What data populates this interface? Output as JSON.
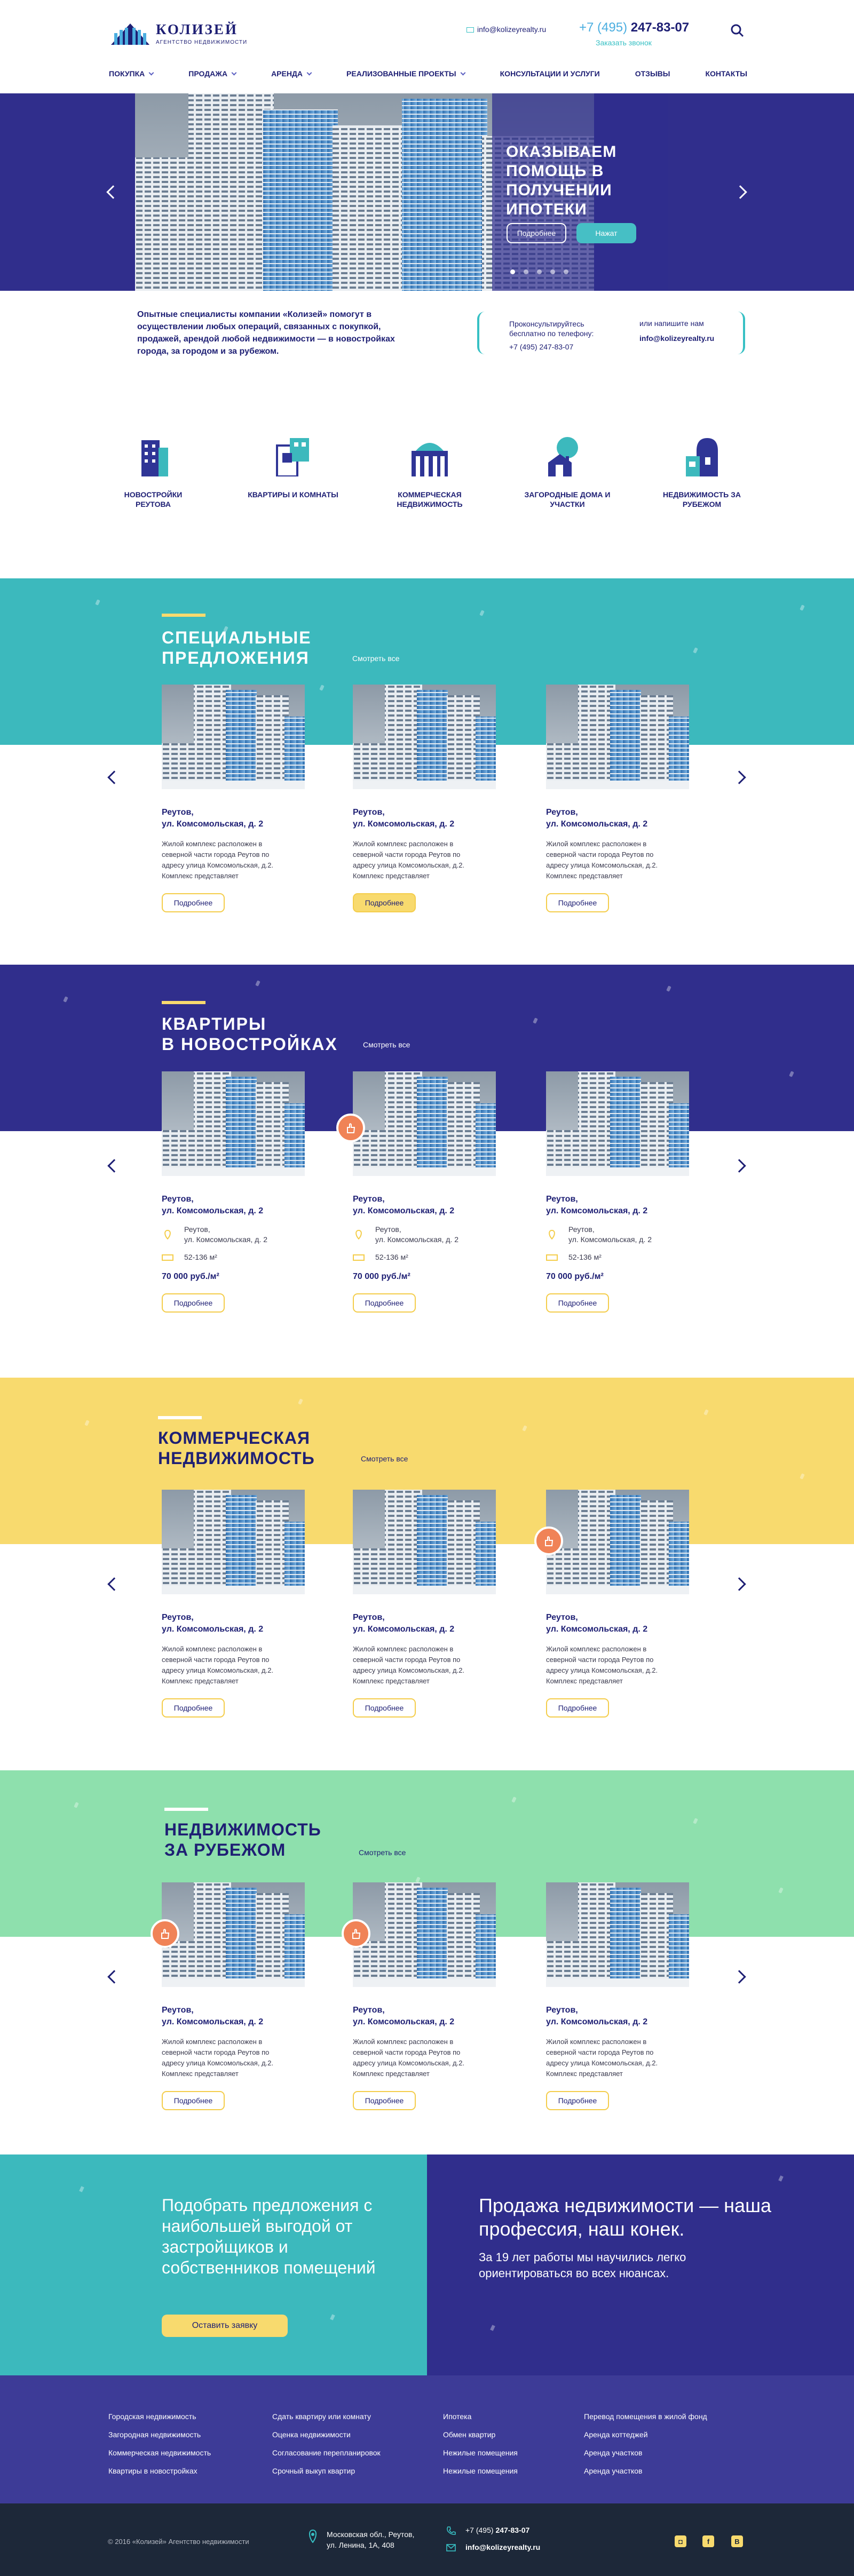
{
  "header": {
    "logo_name": "КОЛИЗЕЙ",
    "logo_sub": "АГЕНТСТВО НЕДВИЖИМОСТИ",
    "email": "info@kolizeyrealty.ru",
    "phone_prefix": "+7 (495)",
    "phone_number": "247-83-07",
    "callback": "Заказать звонок"
  },
  "nav": [
    {
      "label": "ПОКУПКА",
      "dropdown": true
    },
    {
      "label": "ПРОДАЖА",
      "dropdown": true
    },
    {
      "label": "АРЕНДА",
      "dropdown": true
    },
    {
      "label": "РЕАЛИЗОВАННЫЕ ПРОЕКТЫ",
      "dropdown": true
    },
    {
      "label": "КОНСУЛЬТАЦИИ И УСЛУГИ",
      "dropdown": false
    },
    {
      "label": "ОТЗЫВЫ",
      "dropdown": false
    },
    {
      "label": "КОНТАКТЫ",
      "dropdown": false
    }
  ],
  "hero": {
    "title": "Оказываем помощь в получении ипотеки",
    "btn_more": "Подробнее",
    "btn_help": "Нажат",
    "slides": 5,
    "active_slide": 1
  },
  "intro": {
    "text": "Опытные специалисты компании «Колизей» помогут в осуществлении любых операций, связанных с покупкой, продажей, арендой любой недвижимости — в новостройках города, за городом и за рубежом."
  },
  "contact_box": {
    "consult": "Проконсультируйтесь бесплатно по телефону:",
    "phone": "+7 (495) 247-83-07",
    "or_write": "или напишите нам",
    "email": "info@kolizeyrealty.ru"
  },
  "categories": [
    {
      "label": "НОВОСТРОЙКИ РЕУТОВА",
      "icon": "building-icon"
    },
    {
      "label": "КВАРТИРЫ И КОМНАТЫ",
      "icon": "apartments-icon"
    },
    {
      "label": "КОММЕРЧЕСКАЯ НЕДВИЖИМОСТЬ",
      "icon": "commercial-building-icon"
    },
    {
      "label": "ЗАГОРОДНЫЕ ДОМА И УЧАСТКИ",
      "icon": "country-house-icon"
    },
    {
      "label": "НЕДВИЖИМОСТЬ ЗА РУБЕЖОМ",
      "icon": "abroad-house-icon"
    }
  ],
  "common": {
    "see_all": "Смотреть все",
    "more": "Подробнее",
    "card_title_1": "Реутов,",
    "card_title_2": "ул. Комсомольская, д. 2",
    "card_text": "Жилой комплекс расположен в северной части города Реутов по адресу улица Комсомольская, д.2. Комплекс представляет",
    "loc_1": "Реутов,",
    "loc_2": "ул. Комсомольская, д. 2",
    "area": "52-136 м²",
    "price": "70 000 руб./м²"
  },
  "sections": [
    {
      "title_1": "СПЕЦИАЛЬНЫЕ",
      "title_2": "ПРЕДЛОЖЕНИЯ",
      "color": "#3cb9bd"
    },
    {
      "title_1": "КВАРТИРЫ",
      "title_2": "В НОВОСТРОЙКАХ",
      "color": "#302e8c"
    },
    {
      "title_1": "КОММЕРЧЕСКАЯ",
      "title_2": "НЕДВИЖИМОСТЬ",
      "color": "#f8da6e"
    },
    {
      "title_1": "НЕДВИЖИМОСТЬ",
      "title_2": "ЗА РУБЕЖОМ",
      "color": "#8ee0ad"
    }
  ],
  "promo": {
    "left_title": "Подобрать предложения с наибольшей выгодой от застройщиков и собственников помещений",
    "left_btn": "Оставить заявку",
    "right_title": "Продажа недвижимости — наша профессия, наш конек.",
    "right_text": "За 19 лет работы мы научились легко ориентироваться во всех нюансах."
  },
  "footer": {
    "col1": [
      "Городская недвижимость",
      "Загородная недвижимость",
      "Коммерческая недвижимость",
      "Квартиры в новостройках"
    ],
    "col2": [
      "Сдать квартиру или комнату",
      "Оценка недвижимости",
      "Согласование перепланировок",
      "Срочный выкуп квартир"
    ],
    "col3": [
      "Ипотека",
      "Обмен квартир",
      "Нежилые помещения",
      "Нежилые помещения"
    ],
    "col4": [
      "Перевод помещения в жилой фонд",
      "Аренда коттеджей",
      "Аренда участков",
      "Аренда участков"
    ],
    "copyright": "© 2016 «Колизей» Агентство недвижимости",
    "address_1": "Московская обл., Реутов,",
    "address_2": "ул. Ленина, 1А, 408",
    "phone_prefix": "+7 (495)",
    "phone_number": "247-83-07",
    "email": "info@kolizeyrealty.ru",
    "social": [
      "instagram-icon",
      "facebook-icon",
      "vk-icon"
    ]
  },
  "colors": {
    "navy": "#1e1f74",
    "teal": "#3cb9bd",
    "yellow": "#f8da6e",
    "mint": "#8ee0ad",
    "orange": "#f08357",
    "dark": "#1d2839"
  }
}
